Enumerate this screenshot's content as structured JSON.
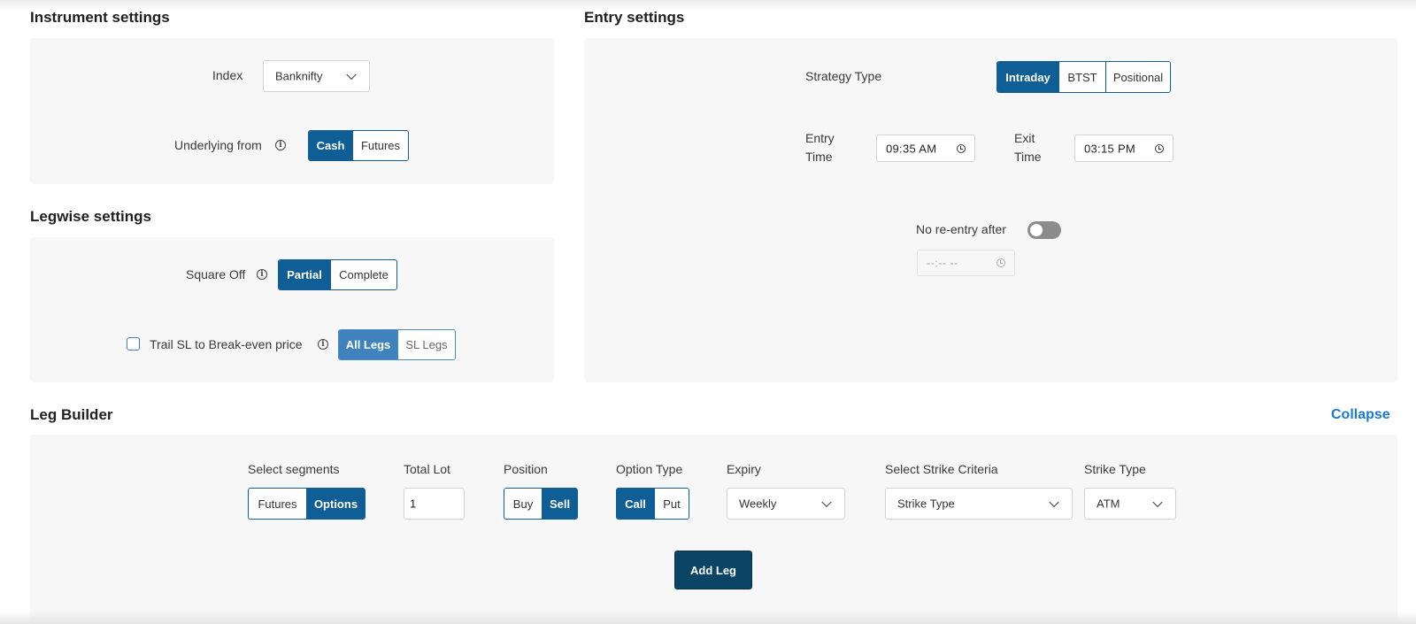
{
  "instrument": {
    "title": "Instrument settings",
    "index_label": "Index",
    "index_value": "Banknifty",
    "underlying_label": "Underlying from",
    "underlying_options": [
      "Cash",
      "Futures"
    ],
    "underlying_selected": "Cash"
  },
  "entry": {
    "title": "Entry settings",
    "strategy_label": "Strategy Type",
    "strategy_options": [
      "Intraday",
      "BTST",
      "Positional"
    ],
    "strategy_selected": "Intraday",
    "entry_time_label_1": "Entry",
    "entry_time_label_2": "Time",
    "entry_time_value": "09:35  AM",
    "exit_time_label_1": "Exit",
    "exit_time_label_2": "Time",
    "exit_time_value": "03:15  PM",
    "no_reentry_label": "No re-entry after",
    "no_reentry_enabled": false,
    "no_reentry_time_value": "--:--  --"
  },
  "legwise": {
    "title": "Legwise settings",
    "square_off_label": "Square Off",
    "square_off_options": [
      "Partial",
      "Complete"
    ],
    "square_off_selected": "Partial",
    "trail_sl_label": "Trail SL to Break-even price",
    "trail_sl_checked": false,
    "trail_options": [
      "All Legs",
      "SL Legs"
    ],
    "trail_selected": "All Legs"
  },
  "leg_builder": {
    "title": "Leg Builder",
    "collapse_label": "Collapse",
    "segments_label": "Select segments",
    "segments_options": [
      "Futures",
      "Options"
    ],
    "segments_selected": "Options",
    "total_lot_label": "Total Lot",
    "total_lot_value": "1",
    "position_label": "Position",
    "position_options": [
      "Buy",
      "Sell"
    ],
    "position_selected": "Sell",
    "option_type_label": "Option Type",
    "option_type_options": [
      "Call",
      "Put"
    ],
    "option_type_selected": "Call",
    "expiry_label": "Expiry",
    "expiry_value": "Weekly",
    "strike_criteria_label": "Select Strike Criteria",
    "strike_criteria_value": "Strike Type",
    "strike_type_label": "Strike Type",
    "strike_type_value": "ATM",
    "add_leg_label": "Add Leg"
  },
  "colors": {
    "primary": "#0f5e96",
    "primary_light": "#3f82bd",
    "button_dark": "#0b4566",
    "link": "#1a7bd6",
    "panel_bg": "#f7f7f7",
    "toggle_off": "#8c8c8c"
  },
  "icons": {
    "info": "info-icon",
    "chevron": "chevron-down-icon",
    "clock": "clock-icon"
  }
}
